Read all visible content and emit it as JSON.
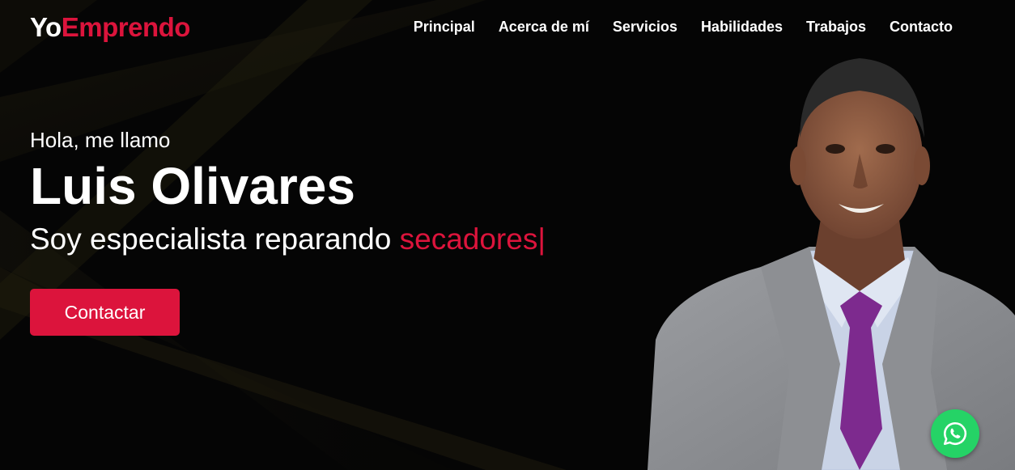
{
  "logo": {
    "part1": "Yo",
    "part2": "Emprendo"
  },
  "nav": {
    "items": [
      {
        "label": "Principal"
      },
      {
        "label": "Acerca de mí"
      },
      {
        "label": "Servicios"
      },
      {
        "label": "Habilidades"
      },
      {
        "label": "Trabajos"
      },
      {
        "label": "Contacto"
      }
    ]
  },
  "hero": {
    "greeting": "Hola, me llamo",
    "name": "Luis Olivares",
    "tagline_prefix": "Soy especialista reparando ",
    "tagline_highlight": "secadores",
    "cursor": "|",
    "cta_label": "Contactar"
  },
  "colors": {
    "accent": "#dc143c",
    "background": "#050505",
    "whatsapp": "#25d366"
  },
  "icons": {
    "whatsapp": "whatsapp-icon"
  }
}
